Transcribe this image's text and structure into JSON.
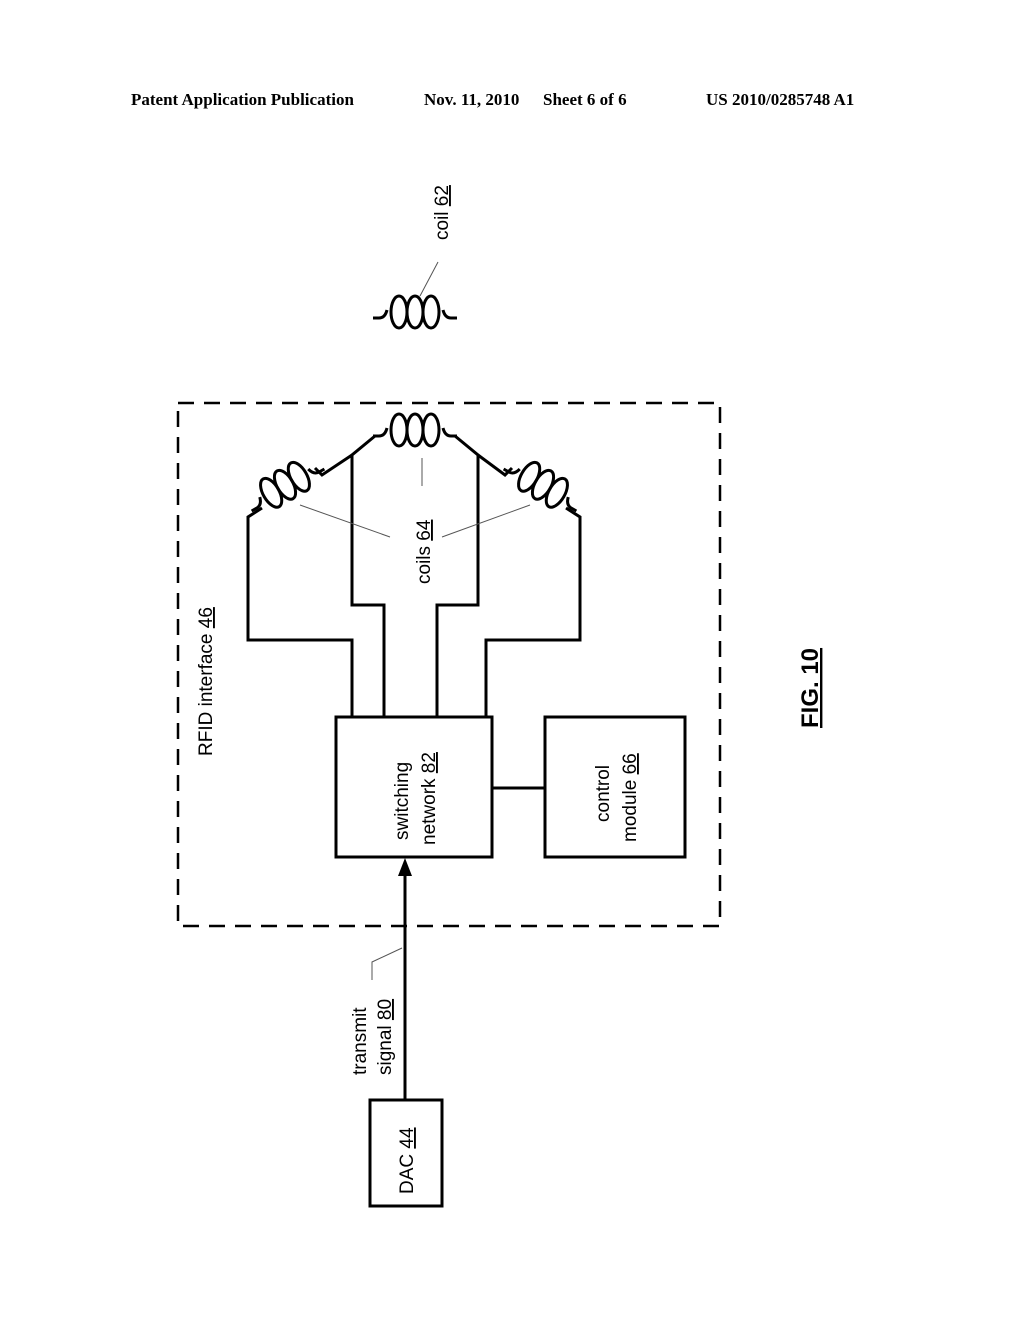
{
  "header": {
    "publication": "Patent Application Publication",
    "date": "Nov. 11, 2010",
    "sheet": "Sheet 6 of 6",
    "number": "US 2010/0285748 A1"
  },
  "figure": {
    "label": "FIG. 10",
    "components": {
      "coil_62": {
        "name": "coil",
        "ref": "62"
      },
      "rfid_interface": {
        "name": "RFID interface",
        "ref": "46"
      },
      "coils_64": {
        "name": "coils",
        "ref": "64"
      },
      "switching_network": {
        "line1": "switching",
        "line2": "network",
        "ref": "82"
      },
      "control_module": {
        "line1": "control",
        "line2": "module",
        "ref": "66"
      },
      "transmit_signal": {
        "line1": "transmit",
        "line2": "signal",
        "ref": "80"
      },
      "dac": {
        "name": "DAC",
        "ref": "44"
      }
    }
  }
}
